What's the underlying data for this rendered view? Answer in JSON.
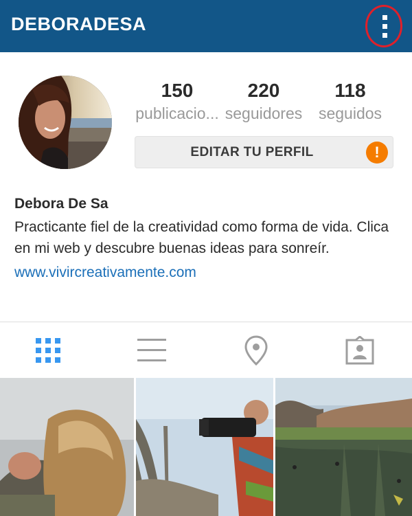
{
  "header": {
    "username": "DEBORADESA",
    "menu_icon": "more-vertical-icon"
  },
  "stats": {
    "posts": {
      "value": "150",
      "label": "publicacio..."
    },
    "followers": {
      "value": "220",
      "label": "seguidores"
    },
    "following": {
      "value": "118",
      "label": "seguidos"
    }
  },
  "edit_profile": {
    "label": "EDITAR TU PERFIL",
    "alert_icon": "exclamation-icon",
    "alert_glyph": "!"
  },
  "bio": {
    "name": "Debora De Sa",
    "text": "Practicante fiel de la creatividad como forma de vida. Clica en mi web y descubre buenas ideas para sonreír.",
    "link": "www.vivircreativamente.com"
  },
  "tabs": [
    {
      "icon": "grid-icon",
      "active": true
    },
    {
      "icon": "list-icon",
      "active": false
    },
    {
      "icon": "location-pin-icon",
      "active": false
    },
    {
      "icon": "tagged-person-icon",
      "active": false
    }
  ],
  "colors": {
    "header_bg": "#125688",
    "active_tab": "#3897f0",
    "inactive_tab": "#9e9e9e",
    "link": "#1b6fb8",
    "alert": "#f57c00",
    "menu_highlight": "#e0202a"
  }
}
